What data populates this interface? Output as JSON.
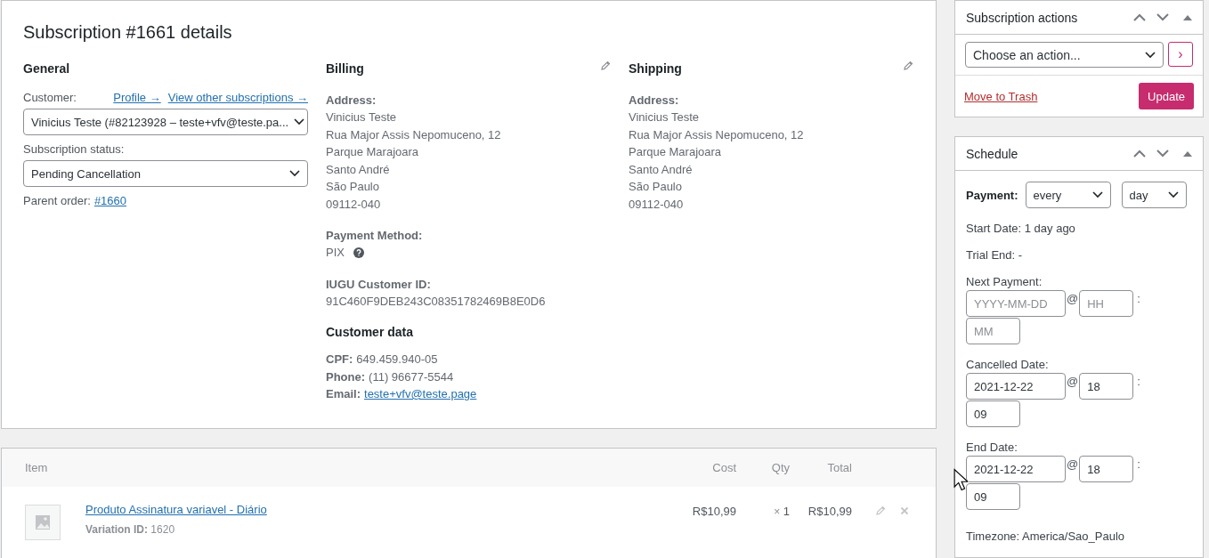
{
  "details": {
    "title": "Subscription #1661 details",
    "general": {
      "heading": "General",
      "customer_label": "Customer:",
      "links": [
        "Profile →",
        "View other subscriptions →"
      ],
      "customer_value": "Vinicius Teste (#82123928 – teste+vfv@teste.pa...",
      "status_label": "Subscription status:",
      "status_value": "Pending Cancellation",
      "parent_label": "Parent order:",
      "parent_link": "#1660"
    },
    "billing": {
      "heading": "Billing",
      "sections": [
        {
          "kind": "lines",
          "label": "Address:",
          "lines": [
            "Vinicius Teste",
            "Rua Major Assis Nepomuceno, 12",
            "Parque Marajoara",
            "Santo André",
            "São Paulo",
            "09112-040"
          ]
        },
        {
          "kind": "help",
          "label": "Payment Method:",
          "lines": [
            "PIX"
          ]
        },
        {
          "kind": "lines",
          "label": "IUGU Customer ID:",
          "lines": [
            "91C460F9DEB243C08351782469B8E0D6"
          ]
        }
      ],
      "customer_data": {
        "heading": "Customer data",
        "rows": [
          {
            "kind": "text",
            "label": "CPF:",
            "value": "649.459.940-05"
          },
          {
            "kind": "text",
            "label": "Phone:",
            "value": "(11) 96677-5544"
          },
          {
            "kind": "link",
            "label": "Email:",
            "value": "teste+vfv@teste.page"
          }
        ]
      }
    },
    "shipping": {
      "heading": "Shipping",
      "label": "Address:",
      "lines": [
        "Vinicius Teste",
        "Rua Major Assis Nepomuceno, 12",
        "Parque Marajoara",
        "Santo André",
        "São Paulo",
        "09112-040"
      ]
    }
  },
  "items": {
    "columns": [
      "Item",
      "Cost",
      "Qty",
      "Total"
    ],
    "rows": [
      {
        "name": "Produto Assinatura variavel - Diário",
        "meta_label": "Variation ID:",
        "meta_value": "1620",
        "cost": "R$10,99",
        "times": "×",
        "qty": "1",
        "total": "R$10,99"
      }
    ]
  },
  "actions": {
    "title": "Subscription actions",
    "select": "Choose an action...",
    "go": "›",
    "trash": "Move to Trash",
    "update": "Update"
  },
  "schedule": {
    "title": "Schedule",
    "payment_label": "Payment:",
    "interval": "every",
    "period": "day",
    "start": "Start Date: 1 day ago",
    "trial": "Trial End: -",
    "dates": [
      {
        "label": "Next Payment:",
        "date": {
          "placeholder": "YYYY-MM-DD"
        },
        "at": "@",
        "hour": {
          "placeholder": "HH"
        },
        "colon": ":",
        "minute": {
          "placeholder": "MM"
        }
      },
      {
        "label": "Cancelled Date:",
        "date": {
          "value": "2021-12-22"
        },
        "at": "@",
        "hour": {
          "value": "18"
        },
        "colon": ":",
        "minute": {
          "value": "09"
        }
      },
      {
        "label": "End Date:",
        "date": {
          "value": "2021-12-22"
        },
        "at": "@",
        "hour": {
          "value": "18"
        },
        "colon": ":",
        "minute": {
          "value": "09"
        }
      }
    ],
    "timezone": "Timezone: America/Sao_Paulo"
  }
}
